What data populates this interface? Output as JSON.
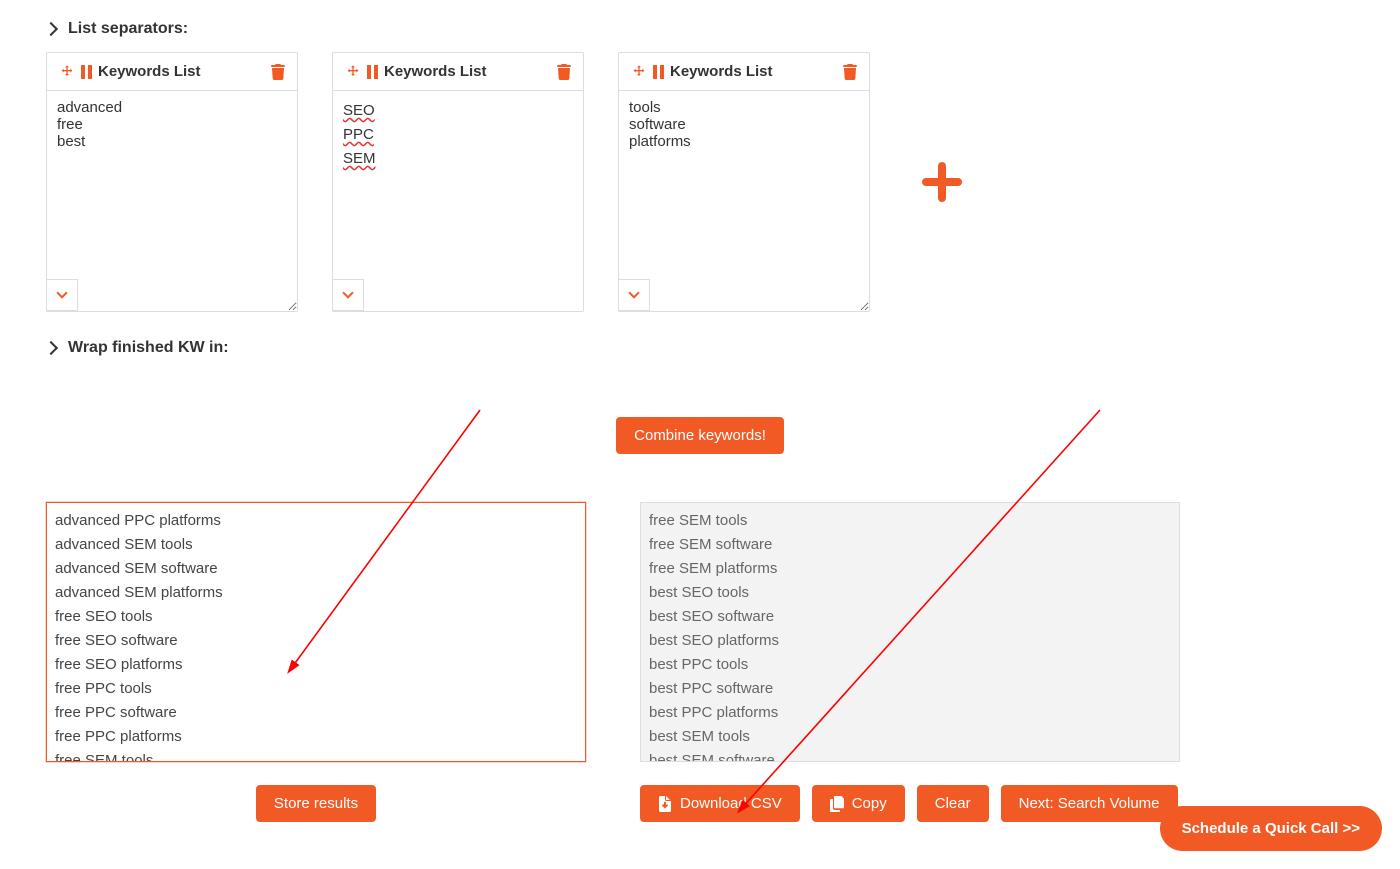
{
  "sections": {
    "list_separators_label": "List separators:",
    "wrap_finished_label": "Wrap finished KW in:"
  },
  "keyword_cards": {
    "header_label": "Keywords List",
    "lists": [
      {
        "text": "advanced\nfree\nbest"
      },
      {
        "text_lines": [
          "SEO",
          "PPC",
          "SEM"
        ],
        "spellcheck": true
      },
      {
        "text": "tools\nsoftware\nplatforms"
      }
    ]
  },
  "buttons": {
    "combine": "Combine keywords!",
    "store_results": "Store results",
    "download_csv": "Download CSV",
    "copy": "Copy",
    "clear": "Clear",
    "next_search_volume": "Next: Search Volume",
    "schedule_call": "Schedule a Quick Call >>"
  },
  "results": {
    "left_text": "advanced PPC platforms\nadvanced SEM tools\nadvanced SEM software\nadvanced SEM platforms\nfree SEO tools\nfree SEO software\nfree SEO platforms\nfree PPC tools\nfree PPC software\nfree PPC platforms\nfree SEM tools",
    "right_text": "free SEM tools\nfree SEM software\nfree SEM platforms\nbest SEO tools\nbest SEO software\nbest SEO platforms\nbest PPC tools\nbest PPC software\nbest PPC platforms\nbest SEM tools\nbest SEM software"
  }
}
